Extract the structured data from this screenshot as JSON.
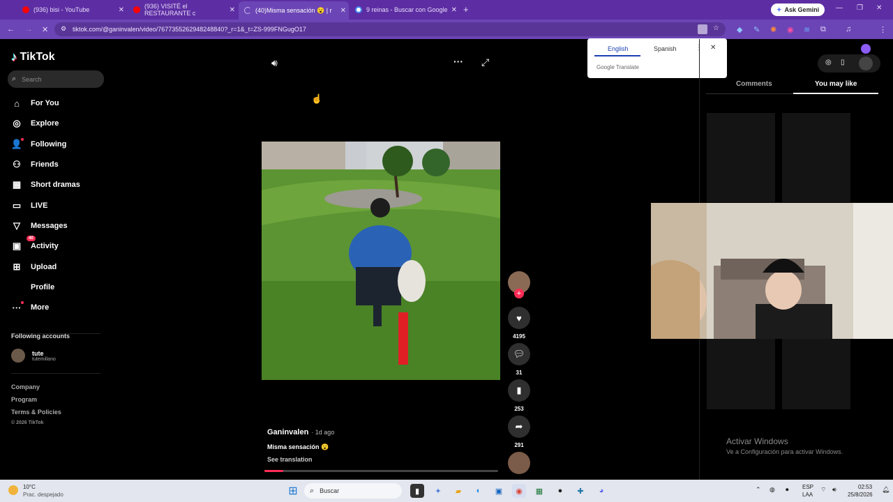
{
  "browser": {
    "tabs": [
      {
        "title": "(936) bisi - YouTube",
        "fav_color": "#ff0000"
      },
      {
        "title": "(936) VISITÉ el RESTAURANTE c",
        "fav_color": "#ff0000"
      },
      {
        "title": "(40)Misma sensación 😮 | n",
        "fav_color": "#c9b8ef"
      },
      {
        "title": "9 reinas - Buscar con Google",
        "fav_color": "#4285f4"
      }
    ],
    "ask_gemini": "Ask Gemini",
    "url": "tiktok.com/@ganinvalen/video/7677355262948248840?_r=1&_t=ZS-999FNGugO17"
  },
  "translate_popup": {
    "tab_english": "English",
    "tab_spanish": "Spanish",
    "footer": "Google Translate"
  },
  "sidebar": {
    "logo": "TikTok",
    "search_placeholder": "Search",
    "nav": [
      {
        "label": "For You",
        "icon": "home-icon"
      },
      {
        "label": "Explore",
        "icon": "compass-icon"
      },
      {
        "label": "Following",
        "icon": "user-follow-icon"
      },
      {
        "label": "Friends",
        "icon": "friends-icon"
      },
      {
        "label": "Short dramas",
        "icon": "film-icon"
      },
      {
        "label": "LIVE",
        "icon": "live-icon"
      },
      {
        "label": "Messages",
        "icon": "send-icon"
      },
      {
        "label": "Activity",
        "icon": "inbox-icon",
        "badge": "40"
      },
      {
        "label": "Upload",
        "icon": "plus-square-icon"
      },
      {
        "label": "Profile",
        "icon": "profile-icon"
      },
      {
        "label": "More",
        "icon": "more-icon"
      }
    ],
    "following_title": "Following accounts",
    "following": [
      {
        "name": "tute",
        "handle": "tutemillano"
      }
    ],
    "footer_links": [
      "Company",
      "Program",
      "Terms & Policies"
    ],
    "copyright": "© 2026 TikTok"
  },
  "video": {
    "author": "Ganinvalen",
    "time": "· 1d ago",
    "caption": "Misma sensación 😮",
    "see_translation": "See translation",
    "progress": 0.08
  },
  "actions": {
    "likes": "4195",
    "comments": "31",
    "saves": "253",
    "shares": "291"
  },
  "right_panel": {
    "tab_comments": "Comments",
    "tab_you_may_like": "You may like"
  },
  "watermark": {
    "line1": "Activar Windows",
    "line2": "Ve a Configuración para activar Windows."
  },
  "taskbar": {
    "weather_temp": "10°C",
    "weather_desc": "Prac. despejado",
    "search": "Buscar",
    "lang1": "ESP",
    "lang2": "LAA",
    "time": "02:53",
    "date": "25/8/2026"
  }
}
